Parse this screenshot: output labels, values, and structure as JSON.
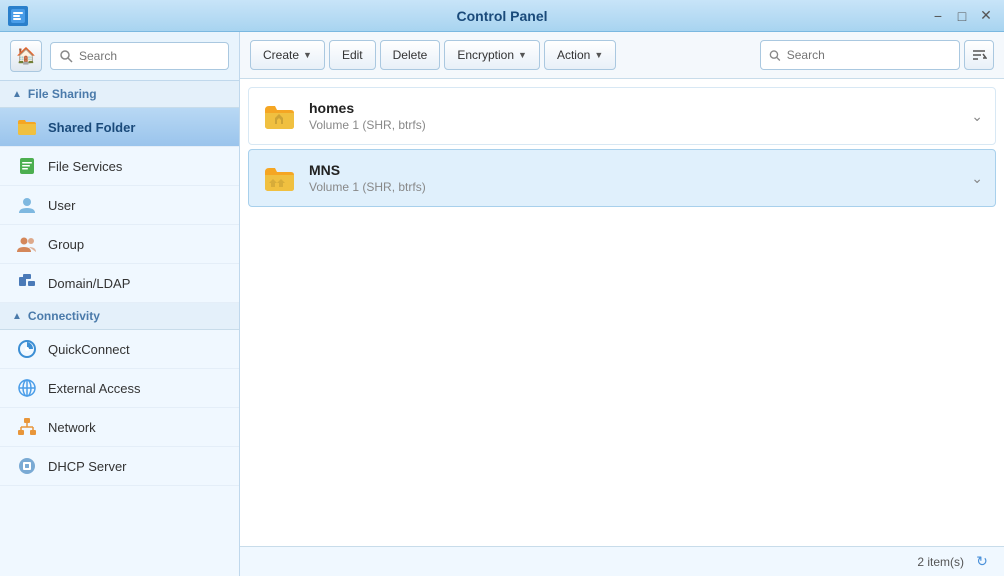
{
  "titleBar": {
    "title": "Control Panel",
    "icon": "🖥"
  },
  "sidebar": {
    "searchPlaceholder": "Search",
    "sections": [
      {
        "id": "file-sharing",
        "label": "File Sharing",
        "expanded": true,
        "items": [
          {
            "id": "shared-folder",
            "label": "Shared Folder",
            "icon": "folder",
            "active": true
          },
          {
            "id": "file-services",
            "label": "File Services",
            "icon": "file-services",
            "active": false
          }
        ]
      },
      {
        "id": "user-group",
        "label": "",
        "expanded": true,
        "items": [
          {
            "id": "user",
            "label": "User",
            "icon": "user",
            "active": false
          },
          {
            "id": "group",
            "label": "Group",
            "icon": "group",
            "active": false
          },
          {
            "id": "domain-ldap",
            "label": "Domain/LDAP",
            "icon": "domain",
            "active": false
          }
        ]
      },
      {
        "id": "connectivity",
        "label": "Connectivity",
        "expanded": true,
        "items": [
          {
            "id": "quickconnect",
            "label": "QuickConnect",
            "icon": "quickconnect",
            "active": false
          },
          {
            "id": "external-access",
            "label": "External Access",
            "icon": "external",
            "active": false
          },
          {
            "id": "network",
            "label": "Network",
            "icon": "network",
            "active": false
          },
          {
            "id": "dhcp-server",
            "label": "DHCP Server",
            "icon": "dhcp",
            "active": false
          }
        ]
      }
    ]
  },
  "toolbar": {
    "createLabel": "Create",
    "editLabel": "Edit",
    "deleteLabel": "Delete",
    "encryptionLabel": "Encryption",
    "actionLabel": "Action",
    "searchPlaceholder": "Search"
  },
  "folders": [
    {
      "id": "homes",
      "name": "homes",
      "sub": "Volume 1 (SHR, btrfs)"
    },
    {
      "id": "mns",
      "name": "MNS",
      "sub": "Volume 1 (SHR, btrfs)"
    }
  ],
  "statusBar": {
    "itemCount": "2 item(s)"
  }
}
